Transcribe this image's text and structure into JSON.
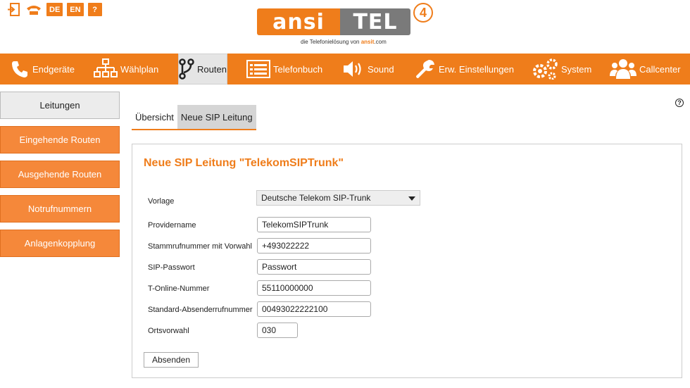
{
  "topbar": {
    "icons": [
      {
        "name": "logout-icon"
      },
      {
        "name": "phone-icon"
      },
      {
        "label": "DE"
      },
      {
        "label": "EN"
      },
      {
        "label": "?"
      }
    ],
    "logo": {
      "left": "ansi",
      "right": "TEL",
      "number": "4",
      "tagline_pre": "die Telefonielösung von",
      "tagline_brand": "ansit",
      "tagline_post": "com"
    }
  },
  "nav": {
    "items": [
      {
        "label": "Endgeräte",
        "icon": "phone-icon"
      },
      {
        "label": "Wählplan",
        "icon": "sitemap-icon"
      },
      {
        "label": "Routen",
        "icon": "route-icon"
      },
      {
        "label": "Telefonbuch",
        "icon": "list-icon"
      },
      {
        "label": "Sound",
        "icon": "speaker-icon"
      },
      {
        "label": "Erw. Einstellungen",
        "icon": "wrench-icon"
      },
      {
        "label": "System",
        "icon": "gears-icon"
      },
      {
        "label": "Callcenter",
        "icon": "users-icon"
      }
    ]
  },
  "sidebar": {
    "items": [
      {
        "label": "Leitungen"
      },
      {
        "label": "Eingehende Routen"
      },
      {
        "label": "Ausgehende Routen"
      },
      {
        "label": "Notrufnummern"
      },
      {
        "label": "Anlagenkopplung"
      }
    ]
  },
  "tabs": [
    {
      "label": "Übersicht"
    },
    {
      "label": "Neue SIP Leitung"
    }
  ],
  "help": "?",
  "form": {
    "title": "Neue SIP Leitung \"TelekomSIPTrunk\"",
    "vorlage_label": "Vorlage",
    "vorlage_value": "Deutsche Telekom SIP-Trunk",
    "fields": [
      {
        "label": "Providername",
        "value": "TelekomSIPTrunk"
      },
      {
        "label": "Stammrufnummer mit Vorwahl",
        "value": "+493022222"
      },
      {
        "label": "SIP-Passwort",
        "value": "Passwort"
      },
      {
        "label": "T-Online-Nummer",
        "value": "55110000000"
      },
      {
        "label": "Standard-Absenderrufnummer",
        "value": "00493022222100"
      },
      {
        "label": "Ortsvorwahl",
        "value": "030"
      }
    ],
    "submit_label": "Absenden"
  },
  "colors": {
    "accent": "#ef7d1b",
    "active_bg": "#e5e5e5"
  }
}
